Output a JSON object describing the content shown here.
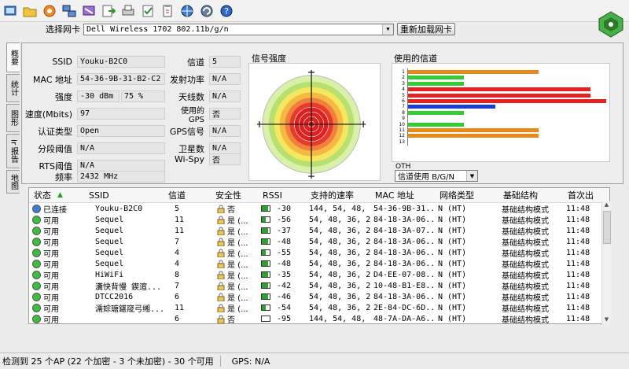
{
  "toolbar": {
    "icons": [
      "start-icon",
      "open-folder-icon",
      "record-icon",
      "network-icon",
      "filter-icon",
      "export-icon",
      "print-icon",
      "checklist-icon",
      "clipboard-icon",
      "globe-icon",
      "update-icon",
      "help-icon"
    ],
    "logo": "inssider-logo-icon"
  },
  "adapter": {
    "label": "选择网卡",
    "selected": "Dell Wireless 1702 802.11b/g/n",
    "reload_label": "重新加载网卡"
  },
  "vtabs": [
    "概要",
    "统计",
    "图形",
    "Ir 报告",
    "地图"
  ],
  "details": {
    "left": [
      {
        "label": "SSID",
        "value": "Youku-B2C0"
      },
      {
        "label": "MAC 地址",
        "value": "54-36-9B-31-B2-C2"
      },
      {
        "label": "强度",
        "value": "-30 dBm",
        "value2": "75 %"
      },
      {
        "label": "速度(Mbits)",
        "value": "97"
      },
      {
        "label": "认证类型",
        "value": "Open"
      },
      {
        "label": "分段阈值",
        "value": "N/A"
      },
      {
        "label": "RTS阈值",
        "value": "N/A"
      },
      {
        "label": "频率",
        "value": "2432 MHz"
      }
    ],
    "right": [
      {
        "label": "信道",
        "value": "5"
      },
      {
        "label": "发射功率",
        "value": "N/A"
      },
      {
        "label": "天线数",
        "value": "N/A"
      },
      {
        "label": "使用的GPS",
        "value": "否"
      },
      {
        "label": "GPS信号",
        "value": "N/A"
      },
      {
        "label": "卫星数",
        "value": "N/A"
      },
      {
        "label": "Wi-Spy",
        "value": "否"
      }
    ]
  },
  "signal_panel": {
    "title": "信号强度"
  },
  "channel_panel": {
    "title": "使用的信道",
    "footer_label": "OTH",
    "select_value": "信道使用 B/G/N",
    "channels": [
      {
        "ch": "1",
        "level": 0.66,
        "color": "#e88a1a"
      },
      {
        "ch": "2",
        "level": 0.28,
        "color": "#33cc33"
      },
      {
        "ch": "3",
        "level": 0.28,
        "color": "#33cc33"
      },
      {
        "ch": "4",
        "level": 0.92,
        "color": "#e82020"
      },
      {
        "ch": "5",
        "level": 0.92,
        "color": "#e82020"
      },
      {
        "ch": "6",
        "level": 1.0,
        "color": "#e82020"
      },
      {
        "ch": "7",
        "level": 0.44,
        "color": "#1a3fd6"
      },
      {
        "ch": "8",
        "level": 0.28,
        "color": "#33cc33"
      },
      {
        "ch": "9",
        "level": 0.0,
        "color": "#33cc33"
      },
      {
        "ch": "10",
        "level": 0.28,
        "color": "#33cc33"
      },
      {
        "ch": "11",
        "level": 0.66,
        "color": "#e88a1a"
      },
      {
        "ch": "12",
        "level": 0.66,
        "color": "#e88a1a"
      },
      {
        "ch": "13",
        "level": 0.0,
        "color": "#33cc33"
      }
    ]
  },
  "table": {
    "columns": [
      "状态",
      "SSID",
      "信道",
      "安全性",
      "RSSI",
      "支持的速率",
      "MAC 地址",
      "网络类型",
      "基础结构",
      "首次出"
    ],
    "rows": [
      {
        "status": "已连接",
        "ssid": "Youku-B2C0",
        "channel": "5",
        "secure": "否",
        "rssi": "-30",
        "rssi_level": 0.75,
        "rates": "144, 54, 48, 3...",
        "mac": "54-36-9B-31...",
        "type": "N (HT)",
        "infra": "基础结构模式",
        "first": "11:48",
        "state": "connected"
      },
      {
        "status": "可用",
        "ssid": "Sequel",
        "channel": "11",
        "secure": "是 (...",
        "rssi": "-56",
        "rssi_level": 0.5,
        "rates": "54, 48, 36, 24...",
        "mac": "84-18-3A-06...",
        "type": "N (HT)",
        "infra": "基础结构模式",
        "first": "11:48",
        "state": "available"
      },
      {
        "status": "可用",
        "ssid": "Sequel",
        "channel": "11",
        "secure": "是 (...",
        "rssi": "-37",
        "rssi_level": 0.75,
        "rates": "54, 48, 36, 24...",
        "mac": "84-18-3A-07...",
        "type": "N (HT)",
        "infra": "基础结构模式",
        "first": "11:48",
        "state": "available"
      },
      {
        "status": "可用",
        "ssid": "Sequel",
        "channel": "7",
        "secure": "是 (...",
        "rssi": "-48",
        "rssi_level": 0.75,
        "rates": "54, 48, 36, 24...",
        "mac": "84-18-3A-06...",
        "type": "N (HT)",
        "infra": "基础结构模式",
        "first": "11:48",
        "state": "available"
      },
      {
        "status": "可用",
        "ssid": "Sequel",
        "channel": "4",
        "secure": "是 (...",
        "rssi": "-55",
        "rssi_level": 0.5,
        "rates": "54, 48, 36, 24...",
        "mac": "84-18-3A-06...",
        "type": "N (HT)",
        "infra": "基础结构模式",
        "first": "11:48",
        "state": "available"
      },
      {
        "status": "可用",
        "ssid": "Sequel",
        "channel": "4",
        "secure": "是 (...",
        "rssi": "-48",
        "rssi_level": 0.75,
        "rates": "54, 48, 36, 24...",
        "mac": "84-18-3A-06...",
        "type": "N (HT)",
        "infra": "基础结构模式",
        "first": "11:48",
        "state": "available"
      },
      {
        "status": "可用",
        "ssid": "HiWiFi",
        "channel": "8",
        "secure": "是 (...",
        "rssi": "-35",
        "rssi_level": 0.75,
        "rates": "54, 48, 36, 24...",
        "mac": "D4-EE-07-08...",
        "type": "N (HT)",
        "infra": "基础结构模式",
        "first": "11:48",
        "state": "available"
      },
      {
        "status": "可用",
        "ssid": "瀵快背慢  鍥逭...",
        "channel": "7",
        "secure": "是 (...",
        "rssi": "-42",
        "rssi_level": 0.75,
        "rates": "54, 48, 36, 24...",
        "mac": "10-48-B1-E8...",
        "type": "N (HT)",
        "infra": "基础结构模式",
        "first": "11:48",
        "state": "available"
      },
      {
        "status": "可用",
        "ssid": "DTCC2016",
        "channel": "6",
        "secure": "是 (...",
        "rssi": "-46",
        "rssi_level": 0.75,
        "rates": "54, 48, 36, 24...",
        "mac": "84-18-3A-06...",
        "type": "N (HT)",
        "infra": "基础结构模式",
        "first": "11:48",
        "state": "available"
      },
      {
        "status": "可用",
        "ssid": "濡婃瑭鍖窚弓缃...",
        "channel": "11",
        "secure": "是 (...",
        "rssi": "-54",
        "rssi_level": 0.5,
        "rates": "54, 48, 36, 24...",
        "mac": "2E-84-DC-6D...",
        "type": "N (HT)",
        "infra": "基础结构模式",
        "first": "11:48",
        "state": "available"
      },
      {
        "status": "可用",
        "ssid": "",
        "channel": "6",
        "secure": "否",
        "rssi": "-95",
        "rssi_level": 0.0,
        "rates": "144, 54, 48, 3...",
        "mac": "48-7A-DA-A6...",
        "type": "N (HT)",
        "infra": "基础结构模式",
        "first": "11:48",
        "state": "available"
      }
    ]
  },
  "statusbar": {
    "summary": "检测到 25 个AP (22 个加密 - 3 个未加密) - 30 个可用",
    "gps": "GPS: N/A"
  },
  "colors": {
    "connected": "#3b7fd8",
    "available": "#3cbf3c",
    "bar_border": "#333333"
  }
}
